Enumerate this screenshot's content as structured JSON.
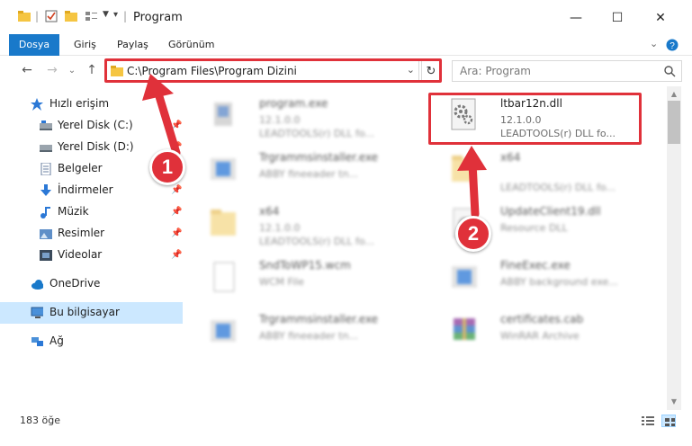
{
  "window": {
    "title": "Program",
    "controls": {
      "minimize": "—",
      "maximize": "☐",
      "close": "✕"
    }
  },
  "ribbon": {
    "tabs": [
      "Dosya",
      "Giriş",
      "Paylaş",
      "Görünüm"
    ],
    "accent": "#1979ca"
  },
  "nav": {
    "back": "←",
    "forward": "→",
    "recent": "⌄",
    "up": "↑",
    "address": "C:\\Program Files\\Program Dizini",
    "refresh": "↻",
    "search_placeholder": "Ara: Program"
  },
  "sidebar": {
    "items": [
      {
        "label": "Hızlı erişim",
        "icon": "star-icon",
        "pinned": false
      },
      {
        "label": "Yerel Disk (C:)",
        "icon": "drive-icon",
        "pinned": true
      },
      {
        "label": "Yerel Disk (D:)",
        "icon": "drive-icon",
        "pinned": true
      },
      {
        "label": "Belgeler",
        "icon": "document-icon",
        "pinned": true
      },
      {
        "label": "İndirmeler",
        "icon": "download-icon",
        "pinned": true
      },
      {
        "label": "Müzik",
        "icon": "music-icon",
        "pinned": true
      },
      {
        "label": "Resimler",
        "icon": "pictures-icon",
        "pinned": true
      },
      {
        "label": "Videolar",
        "icon": "video-icon",
        "pinned": true
      },
      {
        "label": "OneDrive",
        "icon": "cloud-icon",
        "pinned": false
      },
      {
        "label": "Bu bilgisayar",
        "icon": "computer-icon",
        "pinned": false,
        "selected": true
      },
      {
        "label": "Ağ",
        "icon": "network-icon",
        "pinned": false
      }
    ]
  },
  "files": [
    {
      "name": "program.exe",
      "line1": "12.1.0.0",
      "line2": "LEADTOOLS(r) DLL fo...",
      "icon": "exe-icon",
      "blurred": true
    },
    {
      "name": "ltbar12n.dll",
      "line1": "12.1.0.0",
      "line2": "LEADTOOLS(r) DLL fo...",
      "icon": "dll-gear-icon",
      "blurred": false
    },
    {
      "name": "Trgrammsinstaller.exe",
      "line1": "ABBY fineeader tn...",
      "line2": "",
      "icon": "installer-icon",
      "blurred": true
    },
    {
      "name": "x64",
      "line1": "",
      "line2": "LEADTOOLS(r) DLL fo...",
      "icon": "folder-icon",
      "blurred": true
    },
    {
      "name": "x64",
      "line1": "12.1.0.0",
      "line2": "LEADTOOLS(r) DLL fo...",
      "icon": "folder-icon",
      "blurred": true
    },
    {
      "name": "UpdateClient19.dll",
      "line1": "Resource DLL",
      "line2": "",
      "icon": "dll-icon",
      "blurred": true
    },
    {
      "name": "SndToWP15.wcm",
      "line1": "WCM File",
      "line2": "",
      "icon": "file-icon",
      "blurred": true
    },
    {
      "name": "FineExec.exe",
      "line1": "ABBY background exe...",
      "line2": "",
      "icon": "installer-icon",
      "blurred": true
    },
    {
      "name": "Trgrammsinstaller.exe",
      "line1": "ABBY fineeader tn...",
      "line2": "",
      "icon": "installer-icon",
      "blurred": true
    },
    {
      "name": "certificates.cab",
      "line1": "WinRAR Archive",
      "line2": "",
      "icon": "archive-icon",
      "blurred": true
    }
  ],
  "status": {
    "count": "183 öğe"
  },
  "callouts": {
    "one": "1",
    "two": "2"
  },
  "colors": {
    "highlight": "#e0313a",
    "selection": "#cce8ff"
  }
}
